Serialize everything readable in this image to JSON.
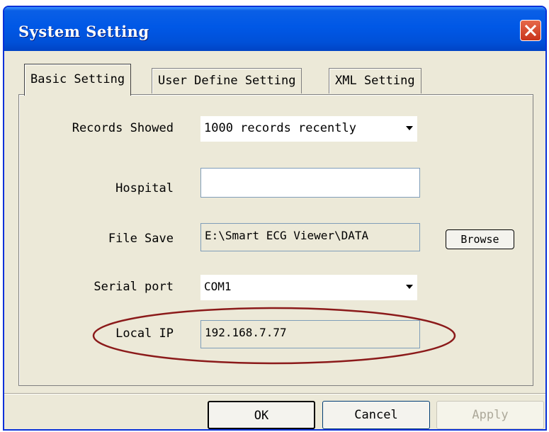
{
  "window": {
    "title": "System Setting"
  },
  "tabs": [
    {
      "label": "Basic Setting",
      "active": true
    },
    {
      "label": "User Define Setting",
      "active": false
    },
    {
      "label": "XML Setting",
      "active": false
    }
  ],
  "form": {
    "records_showed": {
      "label": "Records Showed",
      "value": "1000 records recently"
    },
    "hospital": {
      "label": "Hospital",
      "value": ""
    },
    "file_save": {
      "label": "File Save",
      "value": "E:\\Smart ECG Viewer\\DATA",
      "browse_label": "Browse"
    },
    "serial_port": {
      "label": "Serial port",
      "value": "COM1"
    },
    "local_ip": {
      "label": "Local IP",
      "value": "192.168.7.77"
    }
  },
  "buttons": {
    "ok": "OK",
    "cancel": "Cancel",
    "apply": "Apply"
  },
  "colors": {
    "title_bar": "#0058e6",
    "dialog_bg": "#ece9d8",
    "annotation_ellipse": "#8b1a1a"
  }
}
